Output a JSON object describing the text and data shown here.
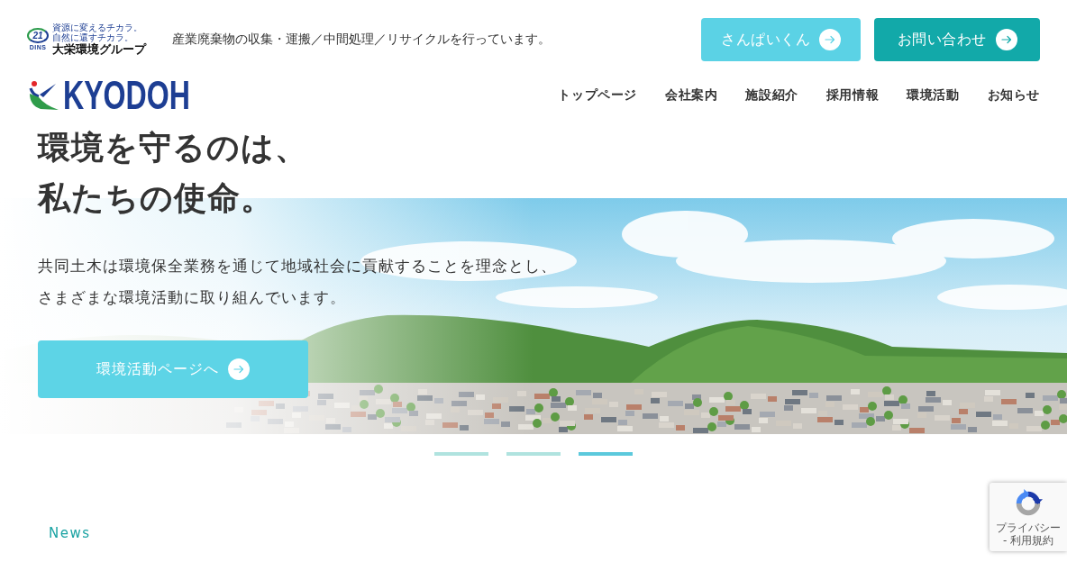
{
  "header": {
    "group_logo": {
      "number": "21",
      "label": "DINS",
      "slogan": "資源に変えるチカラ。自然に還すチカラ。",
      "name": "大栄環境グループ"
    },
    "tagline": "産業廃棄物の収集・運搬／中間処理／リサイクルを行っています。",
    "buttons": [
      {
        "label": "さんぱいくん",
        "kind": "light"
      },
      {
        "label": "お問い合わせ",
        "kind": "dark"
      }
    ],
    "logo": {
      "name": "KYODOH"
    },
    "nav": [
      {
        "label": "トップページ"
      },
      {
        "label": "会社案内"
      },
      {
        "label": "施設紹介"
      },
      {
        "label": "採用情報"
      },
      {
        "label": "環境活動"
      },
      {
        "label": "お知らせ"
      }
    ]
  },
  "hero": {
    "heading_lines": [
      "環境を守るのは、",
      "私たちの使命。"
    ],
    "text_lines": [
      "共同土木は環境保全業務を通じて地域社会に貢献することを理念とし、",
      "さまざまな環境活動に取り組んでいます。"
    ],
    "button": {
      "label": "環境活動ページへ"
    },
    "slides": [
      {
        "selected": false
      },
      {
        "selected": false
      },
      {
        "selected": true
      }
    ]
  },
  "news": {
    "label": "News"
  },
  "captcha": {
    "links": "プライバシー - 利用規約"
  }
}
